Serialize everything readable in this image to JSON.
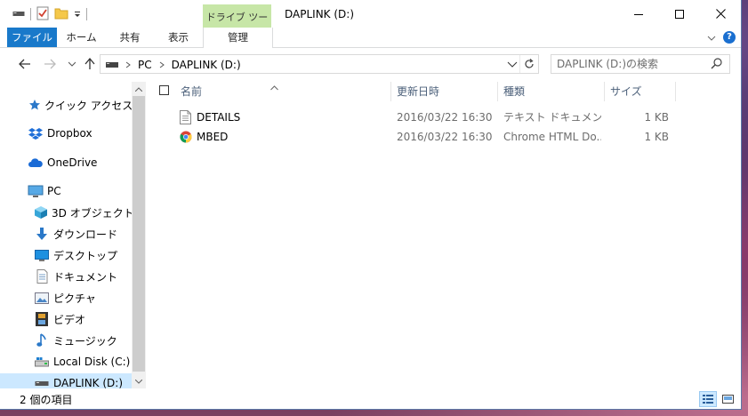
{
  "window": {
    "title": "DAPLINK (D:)",
    "context_tab_group": "ドライブ ツール"
  },
  "ribbon": {
    "tabs": [
      {
        "label": "ファイル"
      },
      {
        "label": "ホーム"
      },
      {
        "label": "共有"
      },
      {
        "label": "表示"
      },
      {
        "label": "管理"
      }
    ],
    "help": "?"
  },
  "address": {
    "crumbs": [
      "PC",
      "DAPLINK (D:)"
    ]
  },
  "search": {
    "placeholder": "DAPLINK (D:)の検索"
  },
  "nav": {
    "items": [
      {
        "label": "クイック アクセス",
        "icon": "star-icon"
      },
      {
        "label": "Dropbox",
        "icon": "dropbox-icon"
      },
      {
        "label": "OneDrive",
        "icon": "cloud-icon"
      },
      {
        "label": "PC",
        "icon": "monitor-icon"
      },
      {
        "label": "3D オブジェクト",
        "icon": "cube-icon"
      },
      {
        "label": "ダウンロード",
        "icon": "download-arrow-icon"
      },
      {
        "label": "デスクトップ",
        "icon": "desktop-icon"
      },
      {
        "label": "ドキュメント",
        "icon": "document-icon"
      },
      {
        "label": "ピクチャ",
        "icon": "picture-icon"
      },
      {
        "label": "ビデオ",
        "icon": "film-icon"
      },
      {
        "label": "ミュージック",
        "icon": "music-note-icon"
      },
      {
        "label": "Local Disk (C:)",
        "icon": "hard-drive-icon"
      },
      {
        "label": "DAPLINK (D:)",
        "icon": "usb-drive-icon"
      }
    ]
  },
  "list": {
    "columns": [
      "名前",
      "更新日時",
      "種類",
      "サイズ"
    ],
    "rows": [
      {
        "name": "DETAILS",
        "date": "2016/03/22 16:30",
        "type": "テキスト ドキュメント",
        "size": "1 KB",
        "icon": "text-file-icon"
      },
      {
        "name": "MBED",
        "date": "2016/03/22 16:30",
        "type": "Chrome HTML Do...",
        "size": "1 KB",
        "icon": "chrome-icon"
      }
    ]
  },
  "status": {
    "item_count": "2 個の項目"
  },
  "colors": {
    "accent": "#1979ca",
    "selection": "#cce8ff",
    "context_tab": "#c7e6a7"
  }
}
